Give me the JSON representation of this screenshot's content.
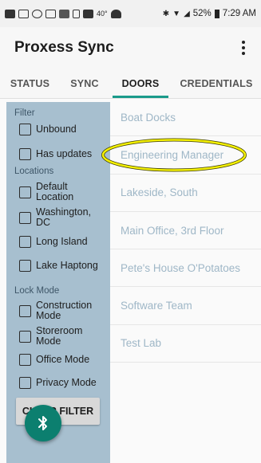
{
  "status_bar": {
    "battery": "52%",
    "time": "7:29 AM",
    "temp": "40°"
  },
  "app": {
    "title": "Proxess Sync"
  },
  "tabs": [
    {
      "label": "STATUS",
      "active": false
    },
    {
      "label": "SYNC",
      "active": false
    },
    {
      "label": "DOORS",
      "active": true
    },
    {
      "label": "CREDENTIALS",
      "active": false
    }
  ],
  "filters": {
    "filter_section": "Filter",
    "filter_items": [
      "Unbound",
      "Has updates"
    ],
    "locations_section": "Locations",
    "location_items": [
      "Default Location",
      "Washington, DC",
      "Long Island",
      "Lake Haptong"
    ],
    "lock_mode_section": "Lock Mode",
    "lock_mode_items": [
      "Construction Mode",
      "Storeroom Mode",
      "Office Mode",
      "Privacy Mode"
    ],
    "clear_button": "CLEAR FILTER"
  },
  "doors": [
    "Boat Docks",
    "Engineering Manager",
    "Lakeside, South",
    "Main Office, 3rd Floor",
    "Pete's House O'Potatoes",
    "Software Team",
    "Test Lab"
  ],
  "colors": {
    "accent": "#1a9a8a",
    "fab": "#0c7f6f",
    "sidebar": "#a7bfcf",
    "door_text": "#9fb7c7",
    "highlight": "#f4f000"
  },
  "icons": {
    "fab": "bluetooth-icon",
    "menu": "overflow-menu-icon"
  }
}
